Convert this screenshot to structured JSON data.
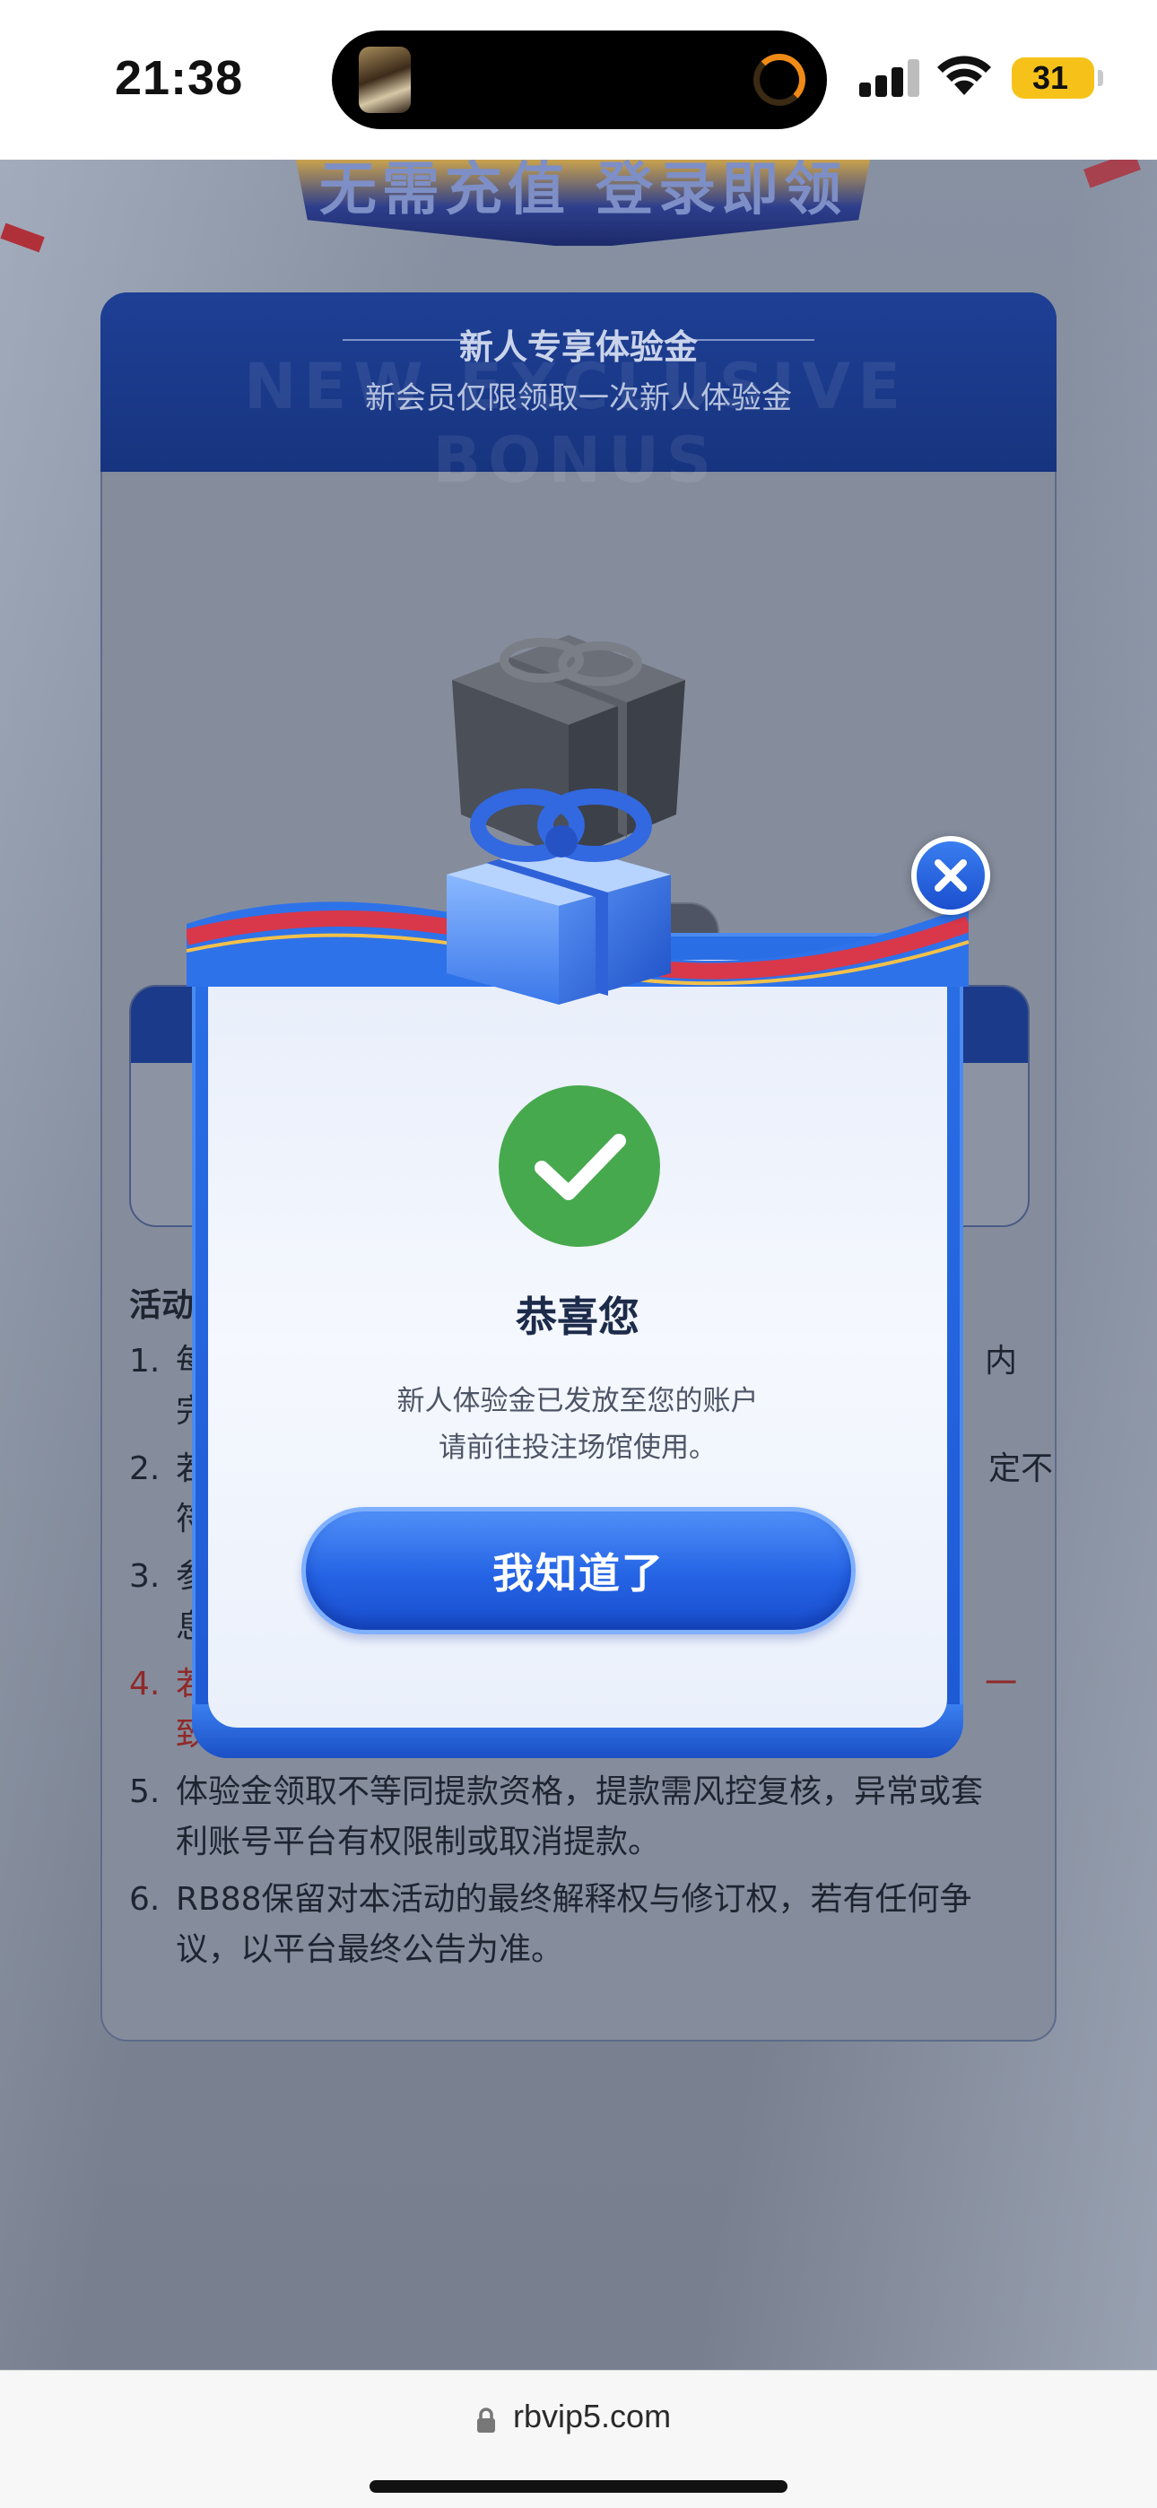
{
  "status_bar": {
    "time": "21:38",
    "battery": "31",
    "icons": [
      "app-thumbnail-icon",
      "activity-ring-icon",
      "cellular-signal-icon",
      "wifi-icon",
      "battery-icon"
    ]
  },
  "background_page": {
    "hero_banner": "无需充值 登录即领",
    "card_title": "新人专享体验金",
    "card_subtitle": "新会员仅限领取一次新人体验金",
    "header_watermark": "NEW EXCLUSIVE BONUS",
    "rules_title": "活动",
    "rules": [
      {
        "num": "1.",
        "text": "每",
        "tail": "内",
        "line2": "完"
      },
      {
        "num": "2.",
        "text": "若",
        "tail": "定不",
        "line2": "符"
      },
      {
        "num": "3.",
        "text": "参",
        "tail": "",
        "line2": "息"
      },
      {
        "num": "4.",
        "text": "若",
        "tail": "一",
        "line2": "致",
        "highlight": true
      },
      {
        "num": "5.",
        "text": "体验金领取不等同提款资格，提款需风控复核，异常或套",
        "line2": "利账号平台有权限制或取消提款。"
      },
      {
        "num": "6.",
        "text": "RB88保留对本活动的最终解释权与修订权，若有任何争",
        "line2": "议，以平台最终公告为准。"
      }
    ]
  },
  "dialog": {
    "title": "恭喜您",
    "message_line1": "新人体验金已发放至您的账户",
    "message_line2": "请前往投注场馆使用。",
    "confirm_label": "我知道了",
    "icons": [
      "gift-box-icon",
      "close-icon",
      "check-icon"
    ]
  },
  "browser": {
    "url": "rbvip5.com"
  },
  "colors": {
    "accent_blue": "#2463e4",
    "success_green": "#47a94e",
    "battery_yellow": "#f6c21a"
  }
}
